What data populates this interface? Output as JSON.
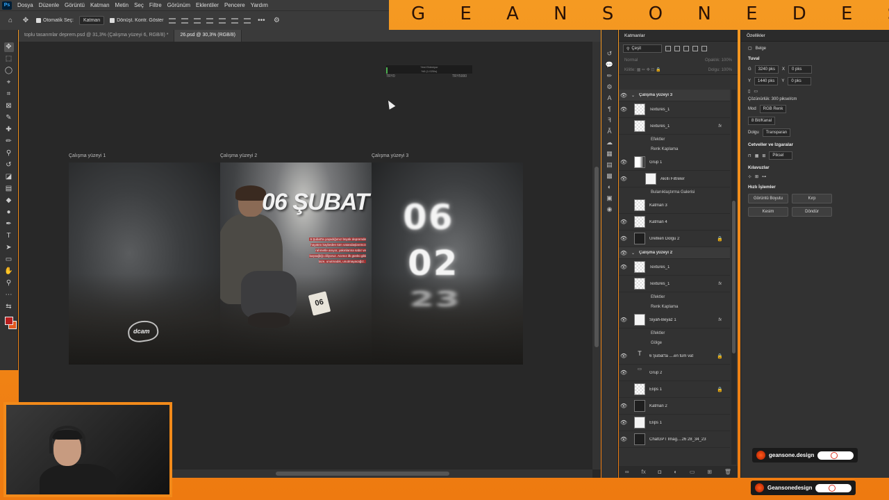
{
  "brand": {
    "title": "G E A N S O N E   D E S I N G"
  },
  "menubar": {
    "logo": "Ps",
    "items": [
      "Dosya",
      "Düzenle",
      "Görüntü",
      "Katman",
      "Metin",
      "Seç",
      "Filtre",
      "Görünüm",
      "Eklentiler",
      "Pencere",
      "Yardım"
    ]
  },
  "options": {
    "auto_select": "Otomatik Seç:",
    "target": "Katman",
    "transform": "Dönüşt. Kontr. Göster"
  },
  "tabs": [
    {
      "label": "toplu tasarımlar deprem.psd @ 31,3% (Çalışma yüzeyi 6, RGB/8) *"
    },
    {
      "label": "26.psd @ 30,3% (RGB/8)"
    }
  ],
  "progress": {
    "title": "Yeni Ekleniyor",
    "value_text": "%6 (1.025/s)",
    "min": "TRY0",
    "max": "TRY5000",
    "fraction": 0.02
  },
  "artboards": {
    "one": "Çalışma yüzeyi 1",
    "two": "Çalışma yüzeyi 2",
    "three": "Çalışma yüzeyi 3"
  },
  "poster": {
    "title": "06 ŞUBAT",
    "body": "6 Şubat'ta yaşadığımız büyük depremde hayatını kaybeden tüm vatandaşlarımızı rahmetle anıyor, yakınlarına sabır ve başsağlığı diliyoruz. Acımız ilk günkü gibi taze, unutmadık, unutmayacağız.",
    "calendar_day": "06",
    "num1": "06",
    "num2": "02",
    "num3": "23",
    "logo": "dcam"
  },
  "layers_panel": {
    "title": "Katmanlar",
    "filter": "Çeşit",
    "blend": "Normal",
    "opacity_label": "Opaklık:",
    "opacity": "100%",
    "lock_label": "Kilitle:",
    "fill_label": "Dolgu:",
    "fill": "100%",
    "rows": [
      {
        "kind": "group",
        "name": "Çalışma yüzeyi 3",
        "eye": true
      },
      {
        "kind": "layer",
        "name": "Textures_1",
        "eye": true,
        "thumb": "check"
      },
      {
        "kind": "layer",
        "name": "Textures_1",
        "eye": false,
        "thumb": "check",
        "fx": "fx"
      },
      {
        "kind": "sub",
        "name": "Efektler"
      },
      {
        "kind": "sub",
        "name": "Renk Kaplama"
      },
      {
        "kind": "layer",
        "name": "Grup 1",
        "eye": true,
        "thumb": "mask"
      },
      {
        "kind": "layer",
        "name": "Akıllı Filtreler",
        "eye": true,
        "thumb": "white",
        "indent": true
      },
      {
        "kind": "sub",
        "name": "Bulanıklaştırma Galerisi"
      },
      {
        "kind": "layer",
        "name": "Katman 3",
        "eye": false,
        "thumb": "check"
      },
      {
        "kind": "layer",
        "name": "Katman 4",
        "eye": true,
        "thumb": "check"
      },
      {
        "kind": "layer",
        "name": "Üretken Dolgu 2",
        "eye": true,
        "thumb": "dark",
        "lock": true
      },
      {
        "kind": "group",
        "name": "Çalışma yüzeyi 2",
        "eye": true
      },
      {
        "kind": "layer",
        "name": "Textures_1",
        "eye": true,
        "thumb": "check"
      },
      {
        "kind": "layer",
        "name": "Textures_1",
        "eye": false,
        "thumb": "check",
        "fx": "fx"
      },
      {
        "kind": "sub",
        "name": "Efektler"
      },
      {
        "kind": "sub",
        "name": "Renk Kaplama"
      },
      {
        "kind": "layer",
        "name": "Siyah-Beyaz 1",
        "eye": true,
        "thumb": "white",
        "fx": "fx"
      },
      {
        "kind": "sub",
        "name": "Efektler"
      },
      {
        "kind": "sub",
        "name": "Gölge"
      },
      {
        "kind": "layer",
        "name": "6 Şubat'ta ....en tüm vat",
        "eye": true,
        "thumb": "text",
        "lock": true
      },
      {
        "kind": "layer",
        "name": "Grup 2",
        "eye": true,
        "thumb": "folder"
      },
      {
        "kind": "layer",
        "name": "Elips 1",
        "eye": false,
        "thumb": "check",
        "lock": true
      },
      {
        "kind": "layer",
        "name": "Katman 2",
        "eye": true,
        "thumb": "dark"
      },
      {
        "kind": "layer",
        "name": "Elips 1",
        "eye": true,
        "thumb": "white"
      },
      {
        "kind": "layer",
        "name": "ChatGPT Imag....26 28_34_23",
        "eye": true,
        "thumb": "dark"
      }
    ]
  },
  "props": {
    "title": "Özellikler",
    "doc": "Belge",
    "canvas_hdr": "Tuval",
    "w_label": "G",
    "w_value": "3240 pks",
    "x_label": "X",
    "x_value": "0 pks",
    "h_label": "Y",
    "h_value": "1440 pks",
    "y_label": "Y",
    "y_value": "0 pks",
    "resolution": "Çözünürlük: 300 piksel/cm",
    "mode_label": "Mod",
    "mode": "RGB Renk",
    "depth": "8 Bit/Kanal",
    "fill_label": "Dolgu",
    "fill": "Transparan",
    "rulers_hdr": "Cetveller ve Izgaralar",
    "units": "Piksel",
    "guides_hdr": "Kılavuzlar",
    "quick_hdr": "Hızlı İşlemler",
    "btn_image_size": "Görüntü Boyutu",
    "btn_crop": "Kırp",
    "btn_trim": "Kesim",
    "btn_rotate": "Döndür"
  },
  "social": {
    "handle1": "geansone.design",
    "handle2": "Geansonedesign"
  }
}
